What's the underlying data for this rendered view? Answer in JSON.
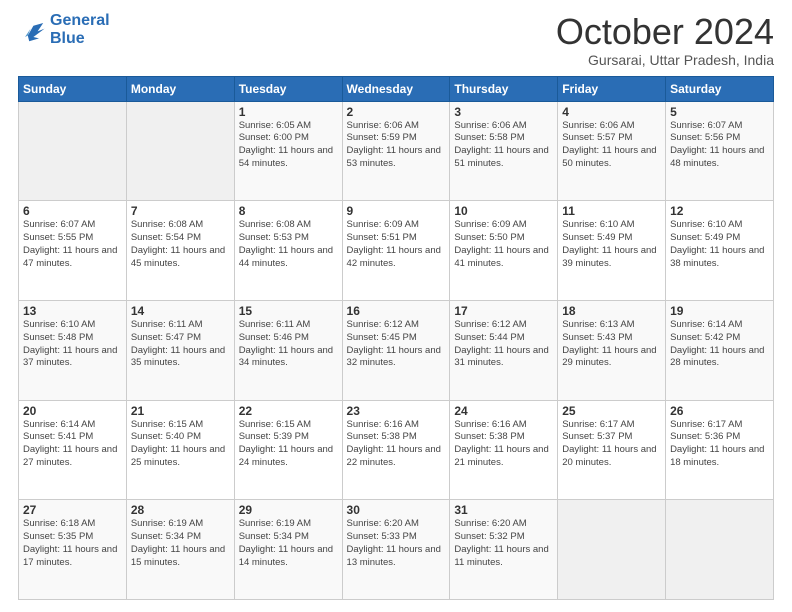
{
  "logo": {
    "line1": "General",
    "line2": "Blue"
  },
  "title": "October 2024",
  "location": "Gursarai, Uttar Pradesh, India",
  "weekdays": [
    "Sunday",
    "Monday",
    "Tuesday",
    "Wednesday",
    "Thursday",
    "Friday",
    "Saturday"
  ],
  "weeks": [
    [
      {
        "day": "",
        "info": ""
      },
      {
        "day": "",
        "info": ""
      },
      {
        "day": "1",
        "info": "Sunrise: 6:05 AM\nSunset: 6:00 PM\nDaylight: 11 hours and 54 minutes."
      },
      {
        "day": "2",
        "info": "Sunrise: 6:06 AM\nSunset: 5:59 PM\nDaylight: 11 hours and 53 minutes."
      },
      {
        "day": "3",
        "info": "Sunrise: 6:06 AM\nSunset: 5:58 PM\nDaylight: 11 hours and 51 minutes."
      },
      {
        "day": "4",
        "info": "Sunrise: 6:06 AM\nSunset: 5:57 PM\nDaylight: 11 hours and 50 minutes."
      },
      {
        "day": "5",
        "info": "Sunrise: 6:07 AM\nSunset: 5:56 PM\nDaylight: 11 hours and 48 minutes."
      }
    ],
    [
      {
        "day": "6",
        "info": "Sunrise: 6:07 AM\nSunset: 5:55 PM\nDaylight: 11 hours and 47 minutes."
      },
      {
        "day": "7",
        "info": "Sunrise: 6:08 AM\nSunset: 5:54 PM\nDaylight: 11 hours and 45 minutes."
      },
      {
        "day": "8",
        "info": "Sunrise: 6:08 AM\nSunset: 5:53 PM\nDaylight: 11 hours and 44 minutes."
      },
      {
        "day": "9",
        "info": "Sunrise: 6:09 AM\nSunset: 5:51 PM\nDaylight: 11 hours and 42 minutes."
      },
      {
        "day": "10",
        "info": "Sunrise: 6:09 AM\nSunset: 5:50 PM\nDaylight: 11 hours and 41 minutes."
      },
      {
        "day": "11",
        "info": "Sunrise: 6:10 AM\nSunset: 5:49 PM\nDaylight: 11 hours and 39 minutes."
      },
      {
        "day": "12",
        "info": "Sunrise: 6:10 AM\nSunset: 5:49 PM\nDaylight: 11 hours and 38 minutes."
      }
    ],
    [
      {
        "day": "13",
        "info": "Sunrise: 6:10 AM\nSunset: 5:48 PM\nDaylight: 11 hours and 37 minutes."
      },
      {
        "day": "14",
        "info": "Sunrise: 6:11 AM\nSunset: 5:47 PM\nDaylight: 11 hours and 35 minutes."
      },
      {
        "day": "15",
        "info": "Sunrise: 6:11 AM\nSunset: 5:46 PM\nDaylight: 11 hours and 34 minutes."
      },
      {
        "day": "16",
        "info": "Sunrise: 6:12 AM\nSunset: 5:45 PM\nDaylight: 11 hours and 32 minutes."
      },
      {
        "day": "17",
        "info": "Sunrise: 6:12 AM\nSunset: 5:44 PM\nDaylight: 11 hours and 31 minutes."
      },
      {
        "day": "18",
        "info": "Sunrise: 6:13 AM\nSunset: 5:43 PM\nDaylight: 11 hours and 29 minutes."
      },
      {
        "day": "19",
        "info": "Sunrise: 6:14 AM\nSunset: 5:42 PM\nDaylight: 11 hours and 28 minutes."
      }
    ],
    [
      {
        "day": "20",
        "info": "Sunrise: 6:14 AM\nSunset: 5:41 PM\nDaylight: 11 hours and 27 minutes."
      },
      {
        "day": "21",
        "info": "Sunrise: 6:15 AM\nSunset: 5:40 PM\nDaylight: 11 hours and 25 minutes."
      },
      {
        "day": "22",
        "info": "Sunrise: 6:15 AM\nSunset: 5:39 PM\nDaylight: 11 hours and 24 minutes."
      },
      {
        "day": "23",
        "info": "Sunrise: 6:16 AM\nSunset: 5:38 PM\nDaylight: 11 hours and 22 minutes."
      },
      {
        "day": "24",
        "info": "Sunrise: 6:16 AM\nSunset: 5:38 PM\nDaylight: 11 hours and 21 minutes."
      },
      {
        "day": "25",
        "info": "Sunrise: 6:17 AM\nSunset: 5:37 PM\nDaylight: 11 hours and 20 minutes."
      },
      {
        "day": "26",
        "info": "Sunrise: 6:17 AM\nSunset: 5:36 PM\nDaylight: 11 hours and 18 minutes."
      }
    ],
    [
      {
        "day": "27",
        "info": "Sunrise: 6:18 AM\nSunset: 5:35 PM\nDaylight: 11 hours and 17 minutes."
      },
      {
        "day": "28",
        "info": "Sunrise: 6:19 AM\nSunset: 5:34 PM\nDaylight: 11 hours and 15 minutes."
      },
      {
        "day": "29",
        "info": "Sunrise: 6:19 AM\nSunset: 5:34 PM\nDaylight: 11 hours and 14 minutes."
      },
      {
        "day": "30",
        "info": "Sunrise: 6:20 AM\nSunset: 5:33 PM\nDaylight: 11 hours and 13 minutes."
      },
      {
        "day": "31",
        "info": "Sunrise: 6:20 AM\nSunset: 5:32 PM\nDaylight: 11 hours and 11 minutes."
      },
      {
        "day": "",
        "info": ""
      },
      {
        "day": "",
        "info": ""
      }
    ]
  ]
}
